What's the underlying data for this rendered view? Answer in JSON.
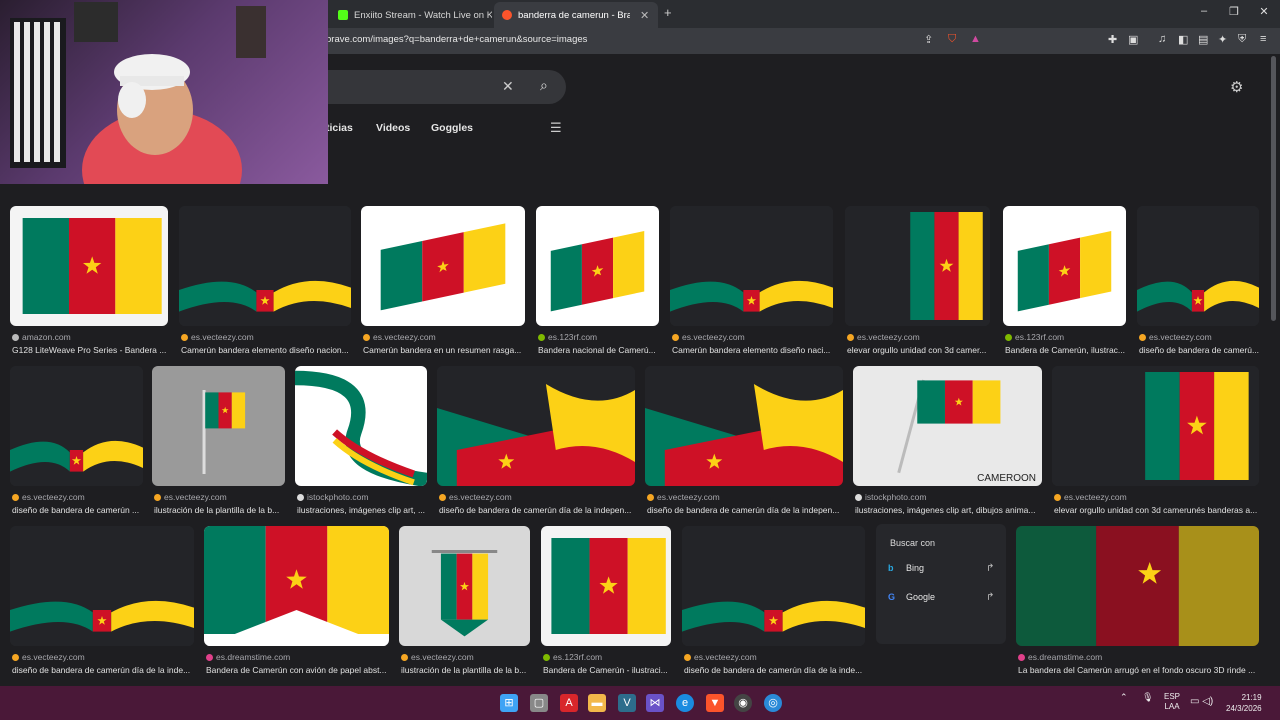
{
  "tabs": [
    {
      "label": "Enxiito Stream - Watch Live on Kick",
      "favicon_color": "#53fc18"
    },
    {
      "label": "banderra de camerun - Brave Se",
      "favicon_color": "#fb542b"
    }
  ],
  "window_controls": {
    "minimize": "–",
    "maximize": "❐",
    "close": "✕"
  },
  "address_bar": {
    "url": "brave.com/images?q=banderra+de+camerun&source=images"
  },
  "search": {
    "clear_icon": "✕",
    "search_icon": "⌕"
  },
  "nav_tabs": [
    "ticias",
    "Videos",
    "Goggles"
  ],
  "results": [
    {
      "source": "amazon.com",
      "source_color": "#bbbbbb",
      "caption": "G128 LiteWeave Pro Series - Bandera ..."
    },
    {
      "source": "es.vecteezy.com",
      "source_color": "#f5a623",
      "caption": "Camerún bandera elemento diseño nacion..."
    },
    {
      "source": "es.vecteezy.com",
      "source_color": "#f5a623",
      "caption": "Camerún bandera en un resumen rasga..."
    },
    {
      "source": "es.123rf.com",
      "source_color": "#7fba00",
      "caption": "Bandera nacional de Camerú..."
    },
    {
      "source": "es.vecteezy.com",
      "source_color": "#f5a623",
      "caption": "Camerún bandera elemento diseño naci..."
    },
    {
      "source": "es.vecteezy.com",
      "source_color": "#f5a623",
      "caption": "elevar orgullo unidad con 3d camer..."
    },
    {
      "source": "es.123rf.com",
      "source_color": "#7fba00",
      "caption": "Bandera de Camerún, ilustrac..."
    },
    {
      "source": "es.vecteezy.com",
      "source_color": "#f5a623",
      "caption": "diseño de bandera de camerú..."
    },
    {
      "source": "es.vecteezy.com",
      "source_color": "#f5a623",
      "caption": "diseño de bandera de camerún ..."
    },
    {
      "source": "es.vecteezy.com",
      "source_color": "#f5a623",
      "caption": "ilustración de la plantilla de la b..."
    },
    {
      "source": "istockphoto.com",
      "source_color": "#dddddd",
      "caption": "ilustraciones, imágenes clip art, ..."
    },
    {
      "source": "es.vecteezy.com",
      "source_color": "#f5a623",
      "caption": "diseño de bandera de camerún día de la indepen..."
    },
    {
      "source": "es.vecteezy.com",
      "source_color": "#f5a623",
      "caption": "diseño de bandera de camerún día de la indepen..."
    },
    {
      "source": "istockphoto.com",
      "source_color": "#dddddd",
      "caption": "ilustraciones, imágenes clip art, dibujos anima..."
    },
    {
      "source": "es.vecteezy.com",
      "source_color": "#f5a623",
      "caption": "elevar orgullo unidad con 3d camerunés banderas a..."
    },
    {
      "source": "es.vecteezy.com",
      "source_color": "#f5a623",
      "caption": "diseño de bandera de camerún día de la inde..."
    },
    {
      "source": "es.dreamstime.com",
      "source_color": "#e0408a",
      "caption": "Bandera de Camerún con avión de papel abst..."
    },
    {
      "source": "es.vecteezy.com",
      "source_color": "#f5a623",
      "caption": "ilustración de la plantilla de la b..."
    },
    {
      "source": "es.123rf.com",
      "source_color": "#7fba00",
      "caption": "Bandera de Camerún - ilustraci..."
    },
    {
      "source": "es.vecteezy.com",
      "source_color": "#f5a623",
      "caption": "diseño de bandera de camerún día de la inde..."
    },
    {
      "source": "es.dreamstime.com",
      "source_color": "#e0408a",
      "caption": "La bandera del Camerún arrugó en el fondo oscuro 3D rinde ..."
    }
  ],
  "thumb_text": {
    "cameroon": "CAMEROON"
  },
  "buscar_con": {
    "title": "Buscar con",
    "engines": [
      "Bing",
      "Google"
    ]
  },
  "taskbar": {
    "lang_top": "ESP",
    "lang_bottom": "LAA",
    "time": "21:19",
    "date": "24/3/2026"
  },
  "colors": {
    "green": "#007a5e",
    "red": "#ce1126",
    "yellow": "#fcd116",
    "taskbar": "#4a1838"
  }
}
